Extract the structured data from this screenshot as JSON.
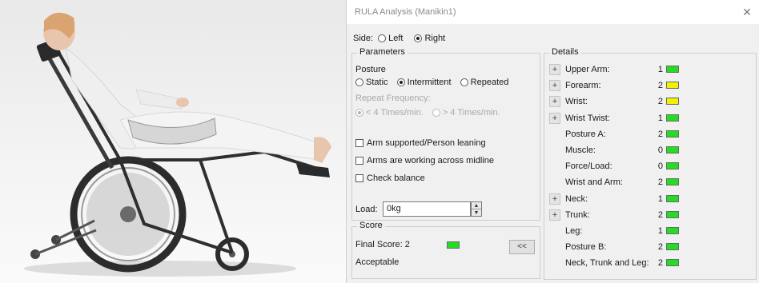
{
  "window": {
    "title": "RULA Analysis (Manikin1)",
    "close_glyph": "✕"
  },
  "side": {
    "label": "Side:",
    "options": [
      {
        "label": "Left",
        "selected": false
      },
      {
        "label": "Right",
        "selected": true
      }
    ]
  },
  "parameters": {
    "legend": "Parameters",
    "posture_label": "Posture",
    "posture_options": [
      {
        "label": "Static",
        "selected": false
      },
      {
        "label": "Intermittent",
        "selected": true
      },
      {
        "label": "Repeated",
        "selected": false
      }
    ],
    "repeat_frequency_label": "Repeat Frequency:",
    "frequency_options": [
      {
        "label": "< 4 Times/min.",
        "selected": true
      },
      {
        "label": "> 4 Times/min.",
        "selected": false
      }
    ],
    "checkboxes": [
      {
        "label": "Arm supported/Person leaning",
        "checked": false
      },
      {
        "label": "Arms are working across midline",
        "checked": false
      },
      {
        "label": "Check balance",
        "checked": false
      }
    ],
    "load_label": "Load:",
    "load_value": "0kg"
  },
  "score": {
    "legend": "Score",
    "final_score_label": "Final Score: 2",
    "final_score_color": "#22dd22",
    "verdict": "Acceptable",
    "collapse_button": "<<"
  },
  "details": {
    "legend": "Details",
    "rows": [
      {
        "label": "Upper Arm:",
        "value": "1",
        "color": "#22dd22",
        "expander": "+"
      },
      {
        "label": "Forearm:",
        "value": "2",
        "color": "#f2f200",
        "expander": "+"
      },
      {
        "label": "Wrist:",
        "value": "2",
        "color": "#f2f200",
        "expander": "+"
      },
      {
        "label": "Wrist Twist:",
        "value": "1",
        "color": "#22dd22",
        "expander": "+"
      },
      {
        "label": "Posture A:",
        "value": "2",
        "color": "#22dd22",
        "expander": ""
      },
      {
        "label": "Muscle:",
        "value": "0",
        "color": "#22dd22",
        "expander": ""
      },
      {
        "label": "Force/Load:",
        "value": "0",
        "color": "#22dd22",
        "expander": ""
      },
      {
        "label": "Wrist and Arm:",
        "value": "2",
        "color": "#22dd22",
        "expander": ""
      },
      {
        "label": "Neck:",
        "value": "1",
        "color": "#22dd22",
        "expander": "+"
      },
      {
        "label": "Trunk:",
        "value": "2",
        "color": "#22dd22",
        "expander": "+"
      },
      {
        "label": "Leg:",
        "value": "1",
        "color": "#22dd22",
        "expander": ""
      },
      {
        "label": "Posture B:",
        "value": "2",
        "color": "#22dd22",
        "expander": ""
      },
      {
        "label": "Neck, Trunk and Leg:",
        "value": "2",
        "color": "#22dd22",
        "expander": ""
      }
    ]
  }
}
